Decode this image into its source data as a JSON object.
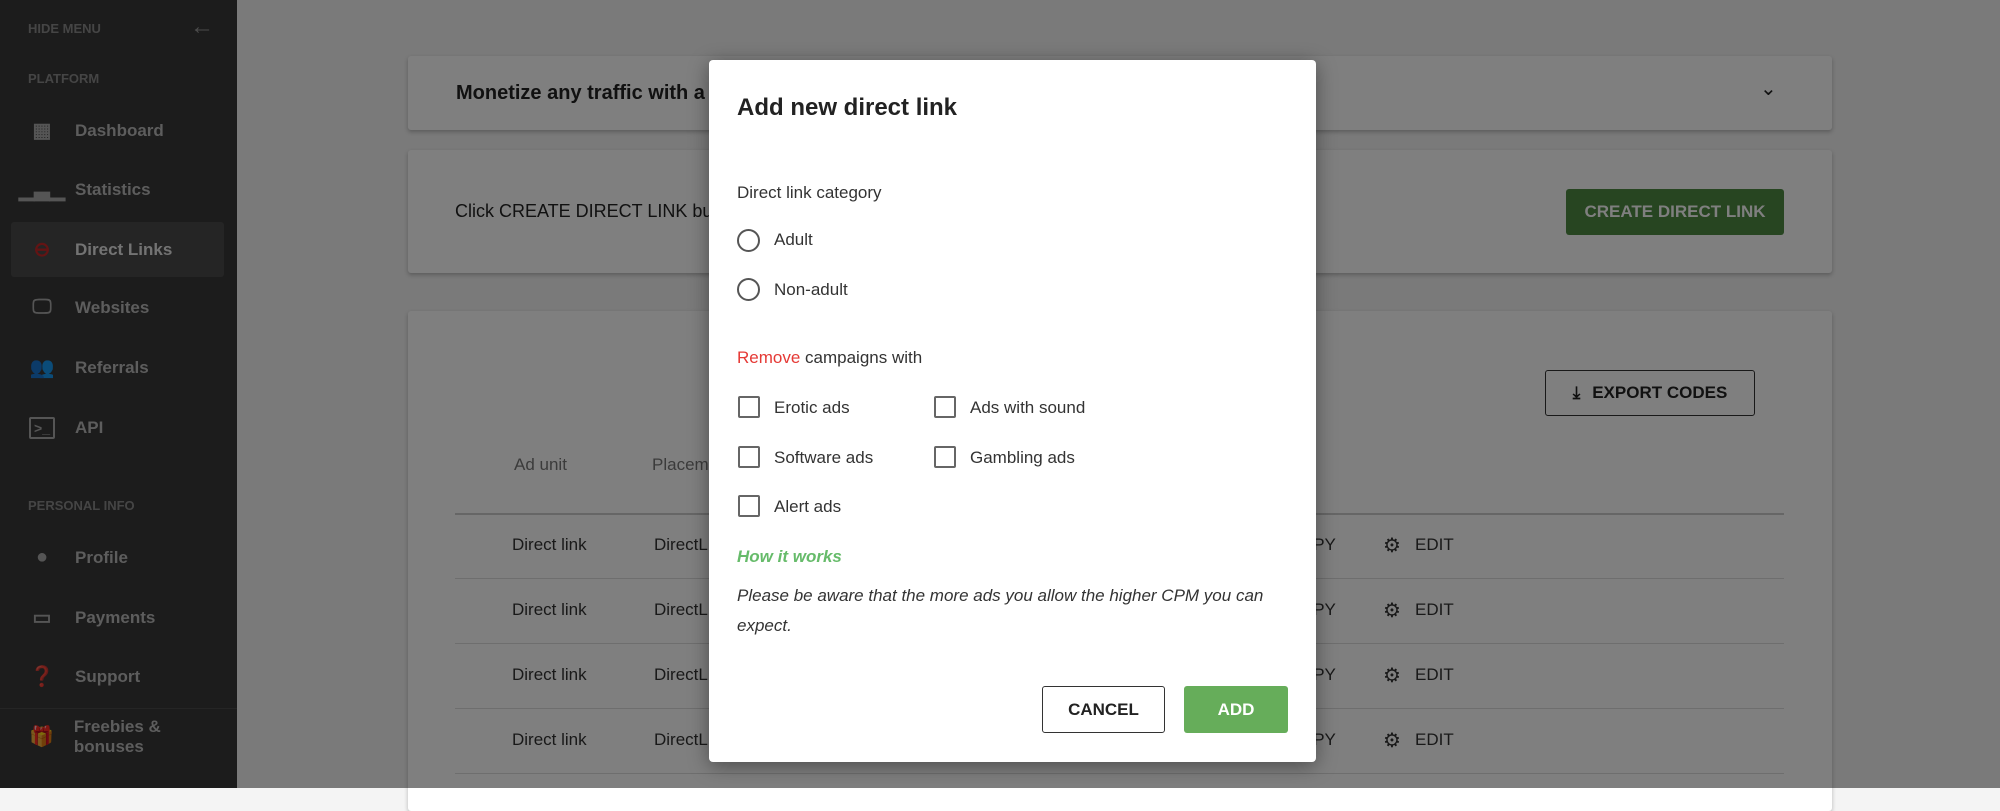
{
  "sidebar": {
    "hide_menu": "HIDE MENU",
    "platform_label": "PLATFORM",
    "personal_label": "PERSONAL INFO",
    "items": [
      {
        "label": "Dashboard",
        "icon": "dashboard-icon"
      },
      {
        "label": "Statistics",
        "icon": "bar-chart-icon"
      },
      {
        "label": "Direct Links",
        "icon": "link-icon",
        "active": true
      },
      {
        "label": "Websites",
        "icon": "monitor-icon"
      },
      {
        "label": "Referrals",
        "icon": "people-icon"
      },
      {
        "label": "API",
        "icon": "terminal-icon"
      },
      {
        "label": "Profile",
        "icon": "account-circle-icon"
      },
      {
        "label": "Payments",
        "icon": "credit-card-icon"
      },
      {
        "label": "Support",
        "icon": "help-icon"
      },
      {
        "label": "Freebies & bonuses",
        "icon": "gift-icon"
      }
    ]
  },
  "main": {
    "banner_text": "Monetize any traffic with a",
    "intro_text": "Click CREATE DIRECT LINK bu",
    "create_button": "CREATE DIRECT LINK",
    "export_button": "EXPORT CODES",
    "table": {
      "headers": [
        "Ad unit",
        "Placem"
      ],
      "rows": [
        {
          "ad_unit": "Direct link",
          "placement": "DirectL",
          "copy": "OPY",
          "edit": "EDIT"
        },
        {
          "ad_unit": "Direct link",
          "placement": "DirectL",
          "copy": "OPY",
          "edit": "EDIT"
        },
        {
          "ad_unit": "Direct link",
          "placement": "DirectL",
          "copy": "OPY",
          "edit": "EDIT"
        },
        {
          "ad_unit": "Direct link",
          "placement": "DirectL",
          "copy": "OPY",
          "edit": "EDIT"
        }
      ]
    }
  },
  "modal": {
    "title": "Add new direct link",
    "category_label": "Direct link category",
    "radios": [
      "Adult",
      "Non-adult"
    ],
    "remove_word": "Remove",
    "remove_rest": " campaigns with",
    "checkboxes": [
      "Erotic ads",
      "Ads with sound",
      "Software ads",
      "Gambling ads",
      "Alert ads"
    ],
    "how_it_works": "How it works",
    "note": "Please be aware that the more ads you allow the higher CPM you can expect.",
    "cancel": "CANCEL",
    "add": "ADD"
  },
  "colors": {
    "accent_green": "#66ad5a",
    "create_green": "#4f8a42",
    "remove_red": "#e53935",
    "link_red": "#d32f2f"
  }
}
